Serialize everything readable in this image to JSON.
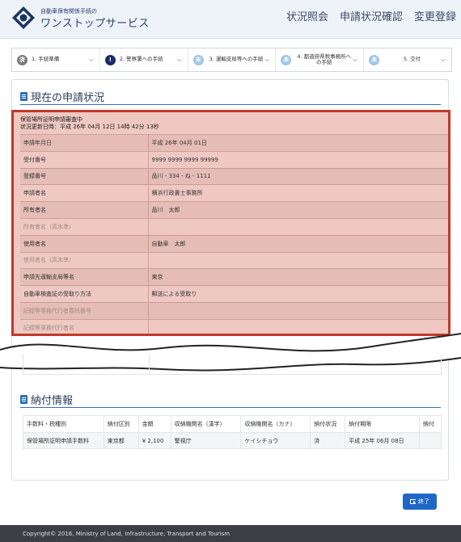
{
  "header": {
    "subtitle": "自動車保有関係手続の",
    "title": "ワンストップサービス",
    "nav": [
      "状況照会",
      "申請状況確認",
      "変更登録"
    ]
  },
  "stepper": {
    "steps": [
      {
        "badge": "済",
        "label": "1. 手続準備",
        "status": "done"
      },
      {
        "badge": "!",
        "label": "2. 警察署への手続",
        "status": "alert"
      },
      {
        "badge": "未",
        "label": "3. 運輸支局等への手続",
        "status": "todo"
      },
      {
        "badge": "未",
        "label": "4. 都道府県税事務所への手続",
        "status": "todo"
      },
      {
        "badge": "未",
        "label": "5. 交付",
        "status": "todo"
      }
    ]
  },
  "status_section": {
    "title": "現在の申請状況",
    "status": "保管場所証明申請審査中",
    "updated": "状況更新日時：平成 26年 04月 12日 14時 42分 13秒",
    "rows": [
      {
        "key": "申請年月日",
        "value": "平成 26年 04月 01日"
      },
      {
        "key": "受付番号",
        "value": "9999 9999 9999 99999"
      },
      {
        "key": "登録番号",
        "value": "品川 - 334 - ね - 1111"
      },
      {
        "key": "申請者名",
        "value": "横浜行政書士事務所"
      },
      {
        "key": "所有者名",
        "value": "品川　太郎"
      },
      {
        "key": "所有者名（高氷準）",
        "value": ""
      },
      {
        "key": "使用者名",
        "value": "自動車　太郎"
      },
      {
        "key": "使用者名（高氷準）",
        "value": ""
      },
      {
        "key": "申請先運輸支局等名",
        "value": "東京"
      },
      {
        "key": "自動車検査証の受取り方法",
        "value": "郵送による受取り"
      },
      {
        "key": "記録等事務代行者委託番号",
        "value": ""
      },
      {
        "key": "記録等事務代行者名",
        "value": ""
      }
    ]
  },
  "payment_section": {
    "title": "納付情報",
    "headers": [
      "手数料・税種別",
      "納付区別",
      "金額",
      "収納機関名（漢字）",
      "収納機関名（カナ）",
      "納付状況",
      "納付期限",
      "納付"
    ],
    "rows": [
      [
        "保管場所証明申請手数料",
        "東京都",
        "¥ 2,100",
        "警視庁",
        "ケイシチョウ",
        "済",
        "平成 25年 06月 08日",
        ""
      ]
    ]
  },
  "finish_button": "終了",
  "footer": "Copyright© 2016, Ministry of Land, Infrastructure, Transport and Tourism",
  "colors": {
    "accent": "#1f66c9",
    "highlight_border": "#c0392b",
    "footer_bg": "#3d3f46"
  }
}
